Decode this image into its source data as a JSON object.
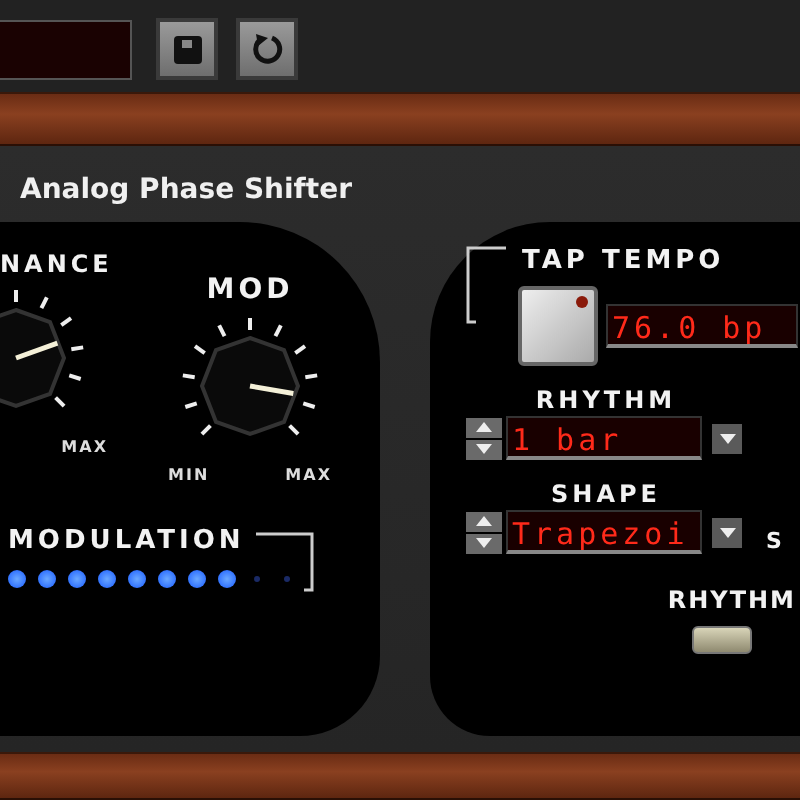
{
  "toolbar": {
    "buttons": [
      {
        "kind": "save"
      },
      {
        "kind": "reset"
      }
    ]
  },
  "title": "Analog Phase Shifter",
  "modulation_panel": {
    "knobs": [
      {
        "label": "NANCE",
        "max": "MAX"
      },
      {
        "label": "MOD",
        "min": "MIN",
        "max": "MAX"
      }
    ],
    "meter_label": "MODULATION",
    "leds": [
      {
        "on": true
      },
      {
        "on": true
      },
      {
        "on": true
      },
      {
        "on": true
      },
      {
        "on": true
      },
      {
        "on": true
      },
      {
        "on": true
      },
      {
        "on": true
      },
      {
        "on": false
      },
      {
        "on": false
      }
    ]
  },
  "tempo_panel": {
    "tap_label": "TAP TEMPO",
    "bpm": "76.0 bp",
    "selectors": [
      {
        "label": "RHYTHM",
        "value": "1 bar"
      },
      {
        "label": "SHAPE",
        "value": "Trapezoi",
        "side": "S"
      }
    ],
    "switch_label": "RHYTHM",
    "switch_on": false
  }
}
